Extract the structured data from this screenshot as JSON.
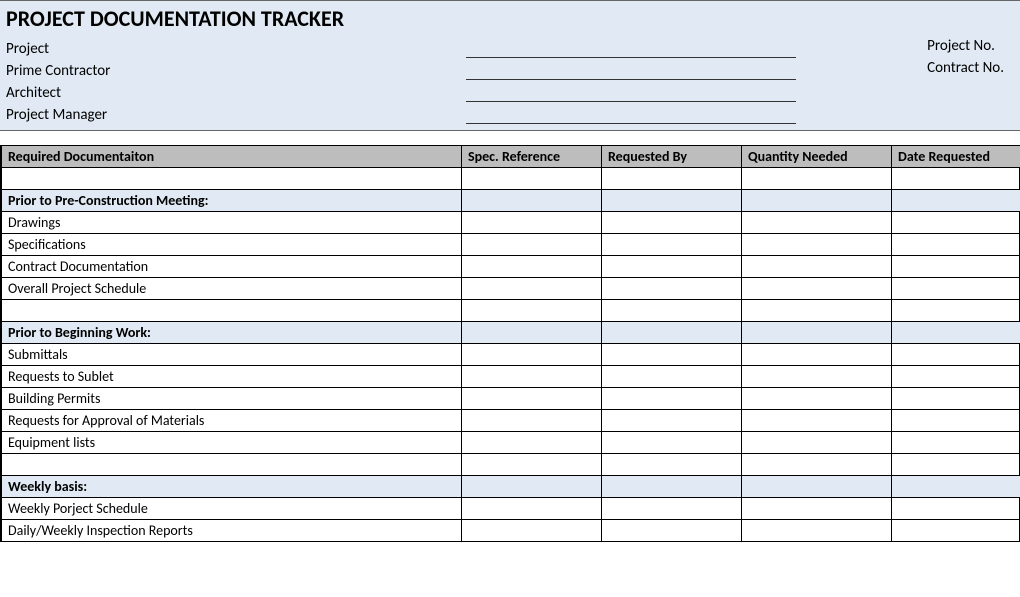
{
  "header": {
    "title": "PROJECT DOCUMENTATION TRACKER",
    "labels": {
      "project": "Project",
      "prime_contractor": "Prime Contractor",
      "architect": "Architect",
      "project_manager": "Project Manager",
      "project_no": "Project No.",
      "contract_no": "Contract No."
    }
  },
  "columns": {
    "c0": "Required Documentaiton",
    "c1": "Spec. Reference",
    "c2": "Requested By",
    "c3": "Quantity Needed",
    "c4": "Date Requested"
  },
  "sections": [
    {
      "title": "Prior to Pre-Construction Meeting:",
      "items": [
        "Drawings",
        "Specifications",
        "Contract Documentation",
        "Overall Project Schedule"
      ]
    },
    {
      "title": "Prior to Beginning Work:",
      "items": [
        "Submittals",
        "Requests to Sublet",
        "Building Permits",
        "Requests for Approval of Materials",
        "Equipment lists"
      ]
    },
    {
      "title": "Weekly basis:",
      "items": [
        "Weekly Porject Schedule",
        "Daily/Weekly Inspection Reports"
      ]
    }
  ]
}
